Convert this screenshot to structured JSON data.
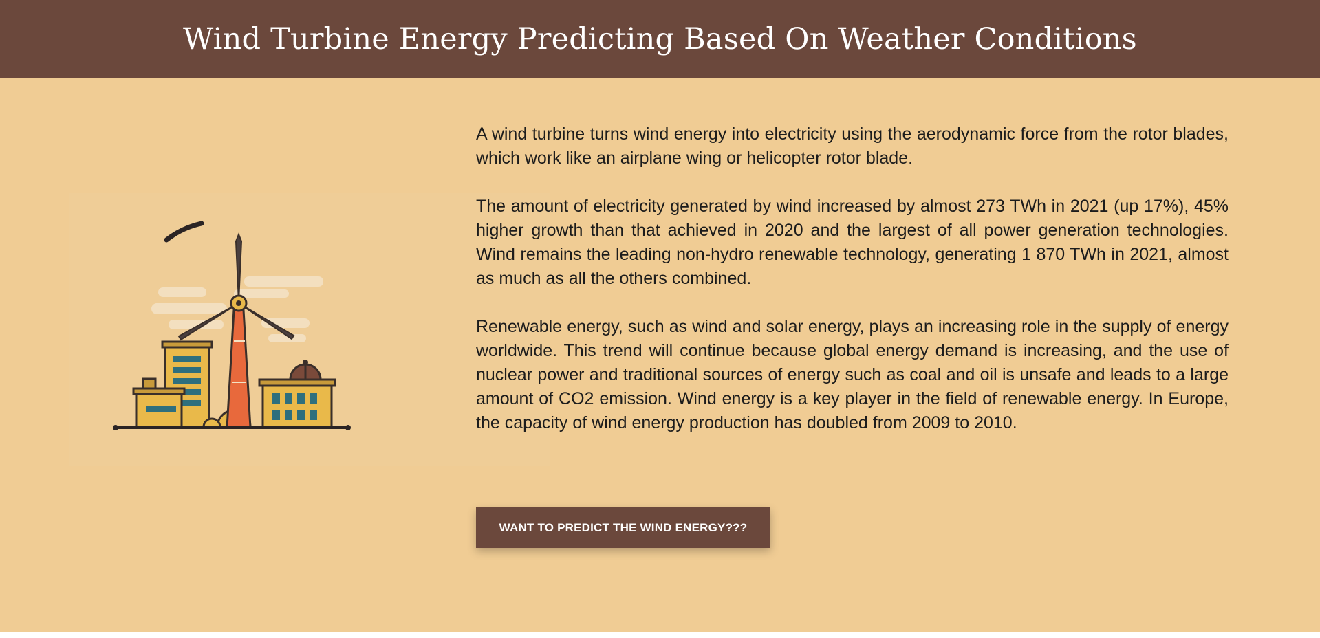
{
  "header": {
    "title": "Wind Turbine Energy Predicting Based On Weather Conditions"
  },
  "illustration": {
    "icon": "wind-turbine-city-illustration"
  },
  "content": {
    "paragraphs": [
      "A wind turbine turns wind energy into electricity using the aerodynamic force from the rotor blades, which work like an airplane wing or helicopter rotor blade.",
      "The amount of electricity generated by wind increased by almost 273 TWh in 2021 (up 17%), 45% higher growth than that achieved in 2020 and the largest of all power generation technologies. Wind remains the leading non-hydro renewable technology, generating 1 870 TWh in 2021, almost as much as all the others combined.",
      "Renewable energy, such as wind and solar energy, plays an increasing role in the supply of energy worldwide. This trend will continue because global energy demand is increasing, and the use of nuclear power and traditional sources of energy such as coal and oil is unsafe and leads to a large amount of CO2 emission. Wind energy is a key player in the field of renewable energy. In Europe, the capacity of wind energy production has doubled from 2009 to 2010."
    ]
  },
  "cta": {
    "label": "WANT TO PREDICT THE WIND ENERGY???"
  },
  "colors": {
    "header_bg": "#6b483c",
    "page_bg": "#f0cc94",
    "button_bg": "#6b483c"
  }
}
